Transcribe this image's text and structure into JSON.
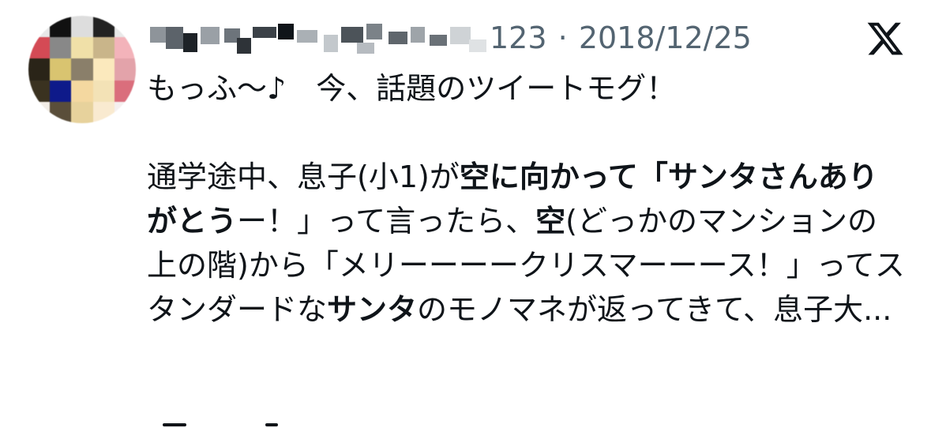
{
  "post": {
    "handle_suffix": "123",
    "separator": "·",
    "date": "2018/12/25",
    "intro": "もっふ〜♪　今、話題のツイートモグ！",
    "body": [
      {
        "text": "通学途中、息子(小1)が",
        "bold": false
      },
      {
        "text": "空に向かって「サンタさんありがとう",
        "bold": true
      },
      {
        "text": "ー！」って言ったら、",
        "bold": false
      },
      {
        "text": "空",
        "bold": true
      },
      {
        "text": "(どっかのマンションの上の階)から「メリーーーークリスマーーース！」ってスタンダードな",
        "bold": false
      },
      {
        "text": "サンタ",
        "bold": true
      },
      {
        "text": "のモノマネが返ってきて、息子大...",
        "bold": false
      }
    ]
  },
  "icons": {
    "platform": "x-logo-icon",
    "avatar": "user-avatar-pixelated",
    "name": "user-name-pixelated"
  },
  "colors": {
    "text": "#0f1419",
    "meta": "#536471",
    "background": "#ffffff"
  }
}
